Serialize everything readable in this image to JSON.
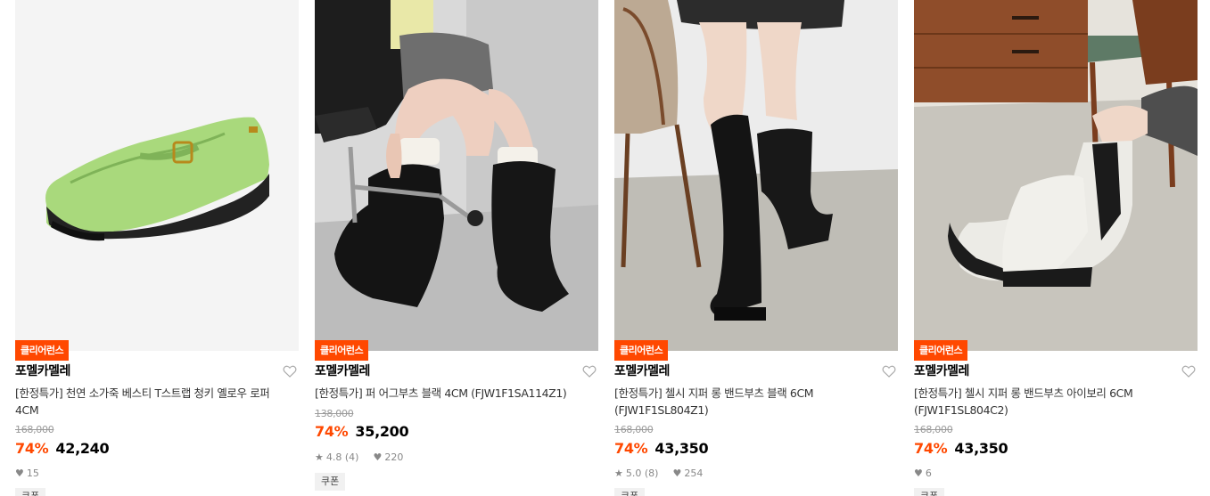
{
  "products": [
    {
      "badge": "클리어런스",
      "brand": "포멜카멜레",
      "title": "[한정특가] 천연 소가죽 베스티 T스트랩 청키 옐로우 로퍼 4CM",
      "original_price": "168,000",
      "discount": "74%",
      "price": "42,240",
      "rating": "",
      "likes": "15",
      "coupon": "쿠폰"
    },
    {
      "badge": "클리어런스",
      "brand": "포멜카멜레",
      "title": "[한정특가] 퍼 어그부츠 블랙 4CM (FJW1F1SA114Z1)",
      "original_price": "138,000",
      "discount": "74%",
      "price": "35,200",
      "rating": "4.8 (4)",
      "likes": "220",
      "coupon": "쿠폰"
    },
    {
      "badge": "클리어런스",
      "brand": "포멜카멜레",
      "title": "[한정특가] 첼시 지퍼 롱 밴드부츠 블랙 6CM (FJW1F1SL804Z1)",
      "original_price": "168,000",
      "discount": "74%",
      "price": "43,350",
      "rating": "5.0 (8)",
      "likes": "254",
      "coupon": "쿠폰"
    },
    {
      "badge": "클리어런스",
      "brand": "포멜카멜레",
      "title": "[한정특가] 첼시 지퍼 롱 밴드부츠 아이보리 6CM (FJW1F1SL804C2)",
      "original_price": "168,000",
      "discount": "74%",
      "price": "43,350",
      "rating": "",
      "likes": "6",
      "coupon": "쿠폰"
    }
  ],
  "colors": {
    "accent": "#ff4800",
    "muted": "#9a9a9a"
  }
}
